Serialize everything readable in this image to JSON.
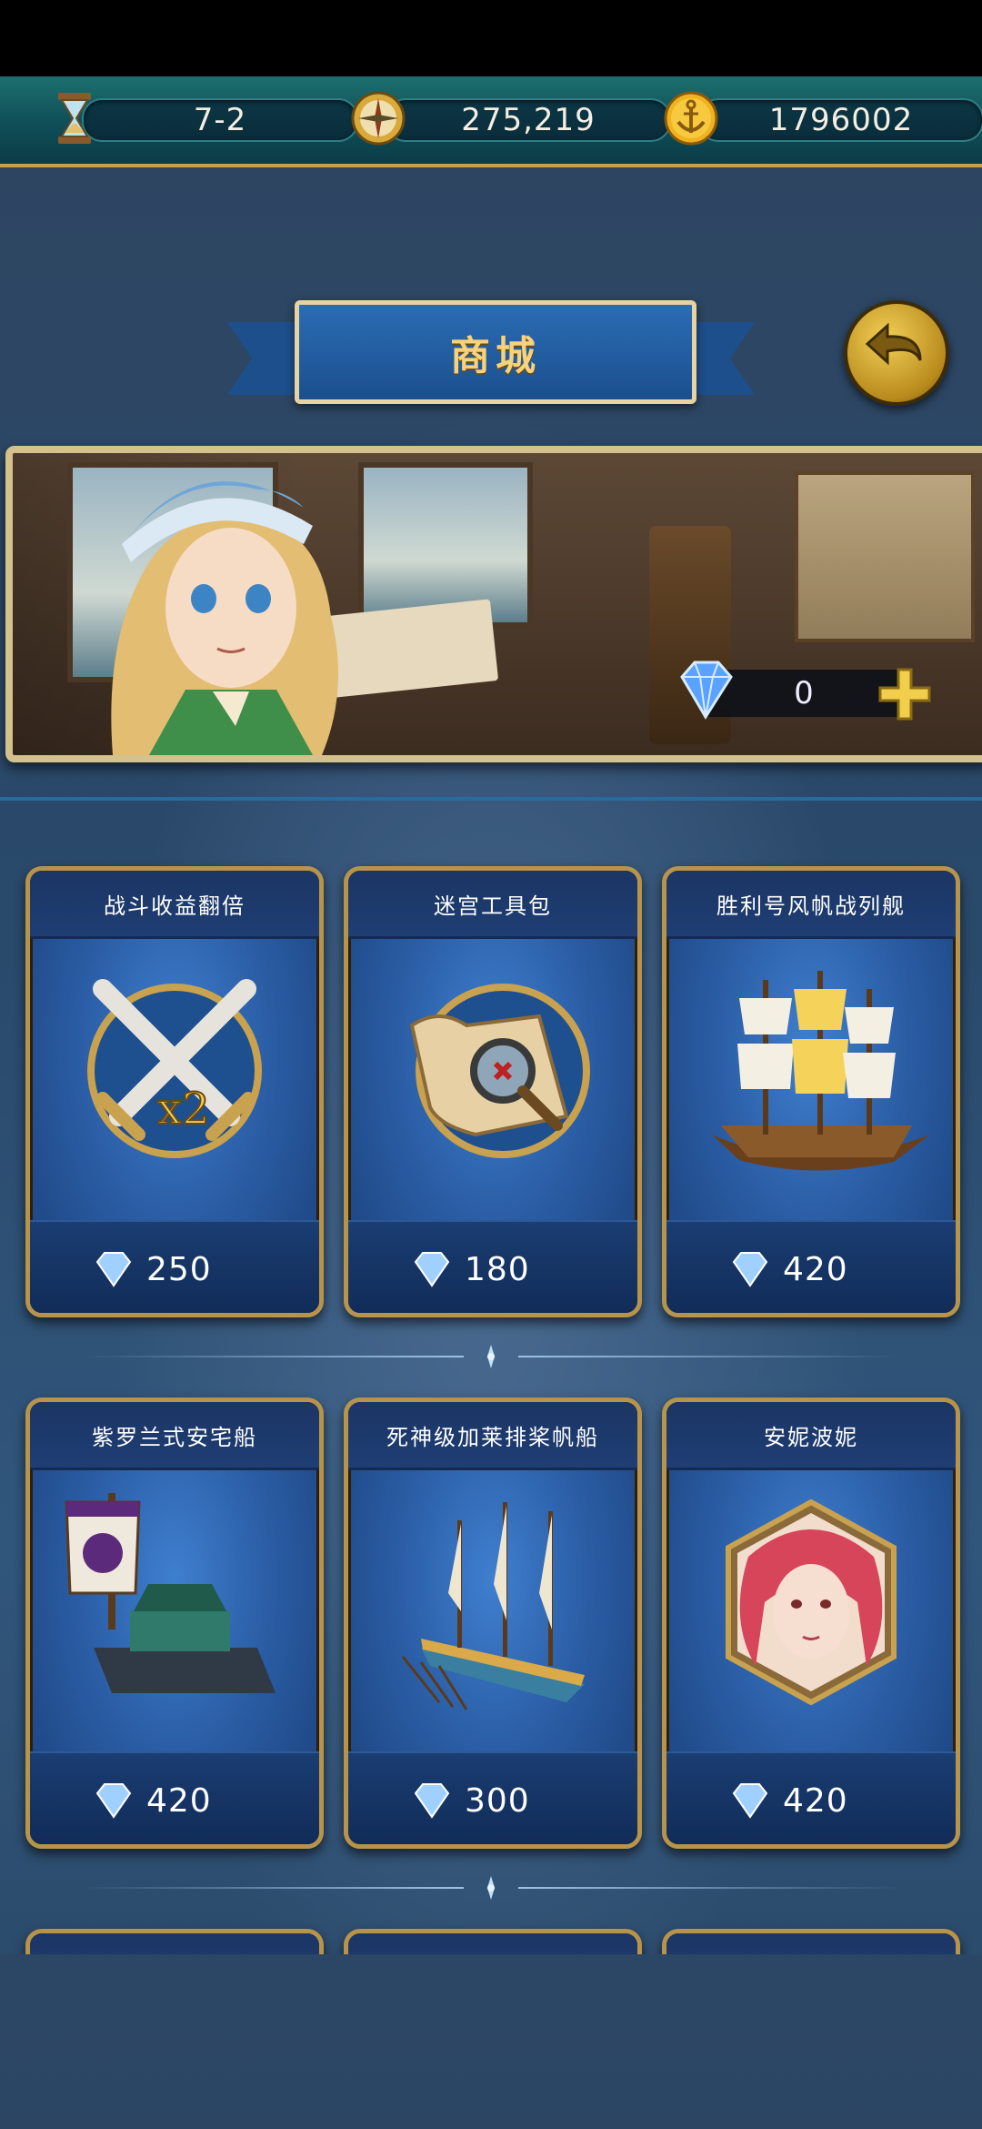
{
  "topbar": {
    "stage": "7-2",
    "compass_value": "275,219",
    "gold": "1796002"
  },
  "header": {
    "title": "商城"
  },
  "gems": {
    "count": "0"
  },
  "shop": {
    "items": [
      {
        "name": "战斗收益翻倍",
        "price": "250",
        "icon": "crossed-swords-x2-icon"
      },
      {
        "name": "迷宫工具包",
        "price": "180",
        "icon": "treasure-map-magnifier-icon"
      },
      {
        "name": "胜利号风帆战列舰",
        "price": "420",
        "icon": "sailing-warship-icon"
      },
      {
        "name": "紫罗兰式安宅船",
        "price": "420",
        "icon": "atakebune-ship-icon"
      },
      {
        "name": "死神级加莱排桨帆船",
        "price": "300",
        "icon": "galley-ship-icon"
      },
      {
        "name": "安妮波妮",
        "price": "420",
        "icon": "anne-bonny-portrait-icon"
      }
    ]
  },
  "colors": {
    "gold": "#c8a14c",
    "card_blue": "#2b5ea6",
    "topbar_teal": "#0f4e57"
  }
}
